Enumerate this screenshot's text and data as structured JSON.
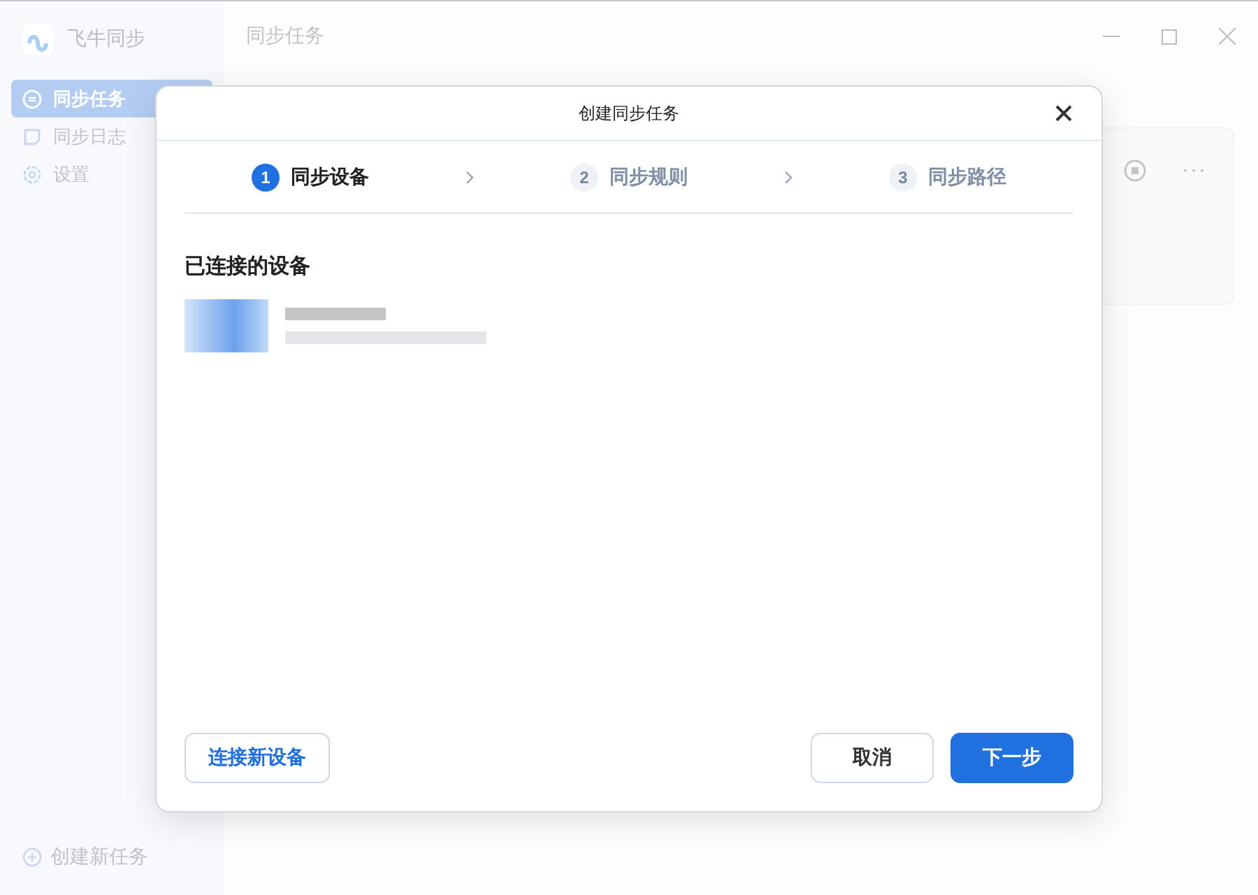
{
  "app": {
    "name": "飞牛同步",
    "header_title": "同步任务"
  },
  "sidebar": {
    "items": [
      {
        "label": "同步任务",
        "kind": "tasks",
        "selected": true
      },
      {
        "label": "同步日志",
        "kind": "log",
        "selected": false
      },
      {
        "label": "设置",
        "kind": "settings",
        "selected": false
      }
    ],
    "create_task": "创建新任务"
  },
  "dialog": {
    "title": "创建同步任务",
    "steps": [
      {
        "number": "1",
        "label": "同步设备",
        "selected": true
      },
      {
        "number": "2",
        "label": "同步规则",
        "selected": false
      },
      {
        "number": "3",
        "label": "同步路径",
        "selected": false
      }
    ],
    "section_title": "已连接的设备",
    "buttons": {
      "connect": "连接新设备",
      "cancel": "取消",
      "next": "下一步"
    }
  }
}
